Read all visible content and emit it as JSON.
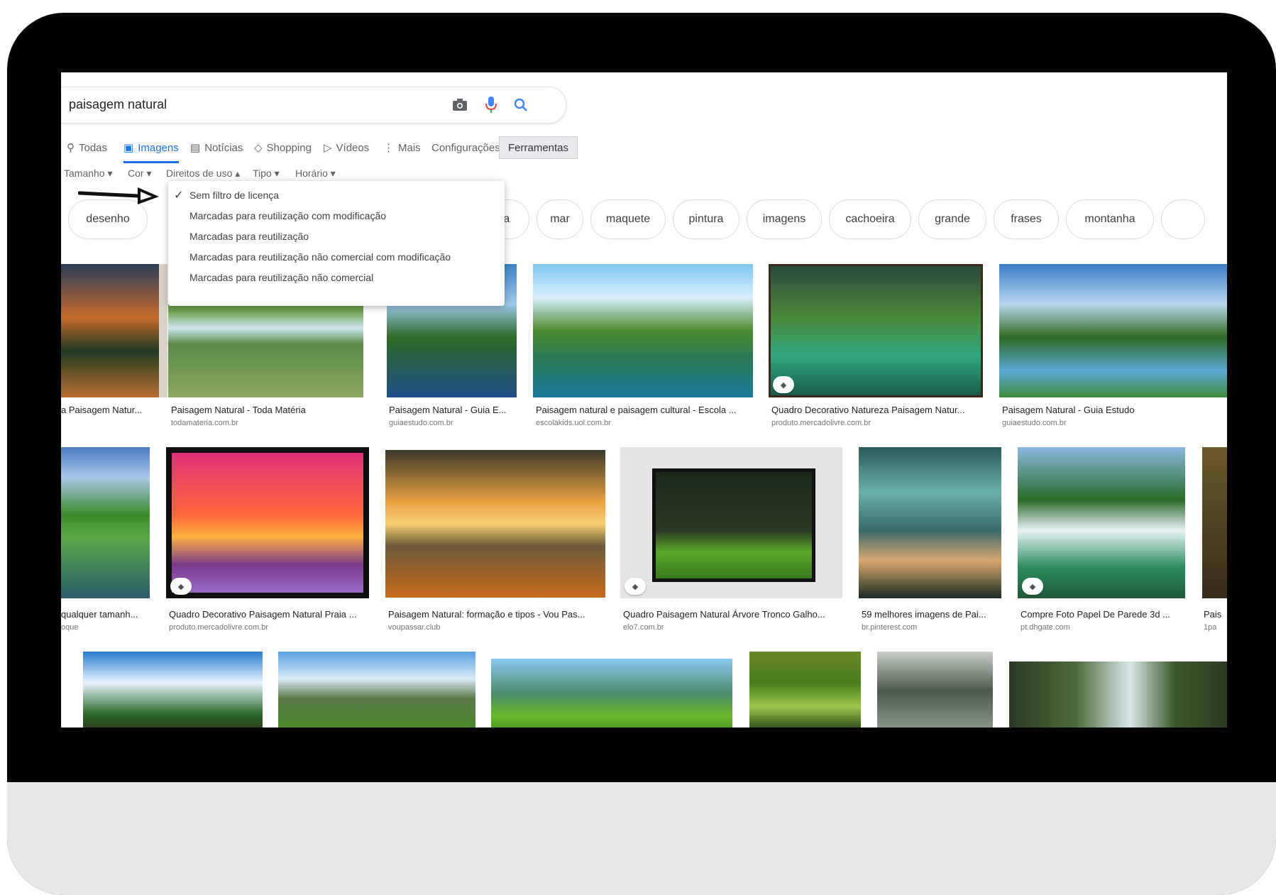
{
  "search": {
    "query": "paisagem natural"
  },
  "tabs": [
    {
      "label": "Todas",
      "icon": "search-icon"
    },
    {
      "label": "Imagens",
      "icon": "image-icon"
    },
    {
      "label": "Notícias",
      "icon": "news-icon"
    },
    {
      "label": "Shopping",
      "icon": "tag-icon"
    },
    {
      "label": "Vídeos",
      "icon": "play-icon"
    },
    {
      "label": "Mais",
      "icon": "more-vert-icon"
    },
    {
      "label": "Configurações"
    },
    {
      "label": "Ferramentas"
    }
  ],
  "filters": [
    "Tamanho",
    "Cor",
    "Direitos de uso",
    "Tipo",
    "Horário"
  ],
  "usage_rights_menu": {
    "selected": "Sem filtro de licença",
    "items": [
      "Sem filtro de licença",
      "Marcadas para reutilização com modificação",
      "Marcadas para reutilização",
      "Marcadas para reutilização não comercial com modificação",
      "Marcadas para reutilização não comercial"
    ]
  },
  "chips": [
    "desenho",
    "floresta",
    "mar",
    "maquete",
    "pintura",
    "imagens",
    "cachoeira",
    "grande",
    "frases",
    "montanha"
  ],
  "results_row1": [
    {
      "title": "a Paisagem Natur...",
      "source": ""
    },
    {
      "title": "Paisagem Natural - Toda Matéria",
      "source": "todamateria.com.br"
    },
    {
      "title": "Paisagem Natural - Guia E...",
      "source": "guiaestudo.com.br"
    },
    {
      "title": "Paisagem natural e paisagem cultural - Escola ...",
      "source": "escolakids.uol.com.br"
    },
    {
      "title": "Quadro Decorativo Natureza Paisagem Natur...",
      "source": "produto.mercadolivre.com.br"
    },
    {
      "title": "Paisagem Natural - Guia Estudo",
      "source": "guiaestudo.com.br"
    }
  ],
  "results_row2": [
    {
      "title": "qualquer tamanh...",
      "source": "oque"
    },
    {
      "title": "Quadro Decorativo Paisagem Natural Praia ...",
      "source": "produto.mercadolivre.com.br"
    },
    {
      "title": "Paisagem Natural: formação e tipos - Vou Pas...",
      "source": "voupassar.club"
    },
    {
      "title": "Quadro Paisagem Natural Árvore Tronco Galho...",
      "source": "elo7.com.br"
    },
    {
      "title": "59 melhores imagens de Pai...",
      "source": "br.pinterest.com"
    },
    {
      "title": "Compre Foto Papel De Parede 3d ...",
      "source": "pt.dhgate.com"
    },
    {
      "title": "Pais",
      "source": "1pa"
    }
  ]
}
